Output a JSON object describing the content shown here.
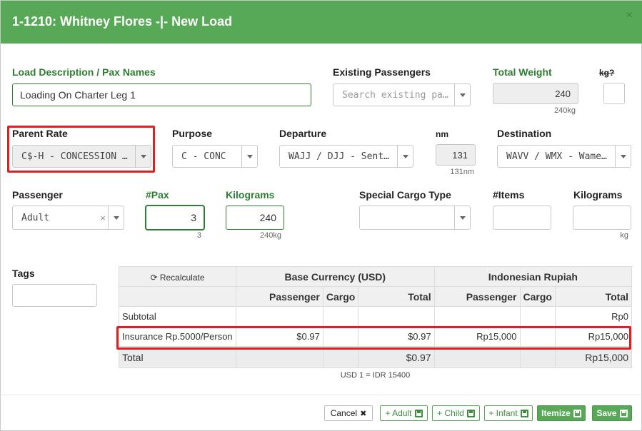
{
  "header": {
    "title": "1-1210: Whitney Flores -|- New Load",
    "close_glyph": "×"
  },
  "load_description": {
    "label": "Load Description / Pax Names",
    "value": "Loading On Charter Leg 1"
  },
  "existing_passengers": {
    "label": "Existing Passengers",
    "placeholder": "Search existing pa…"
  },
  "total_weight": {
    "label": "Total Weight",
    "value": "240",
    "sub": "240kg"
  },
  "kg_toggle": {
    "label": "kg?"
  },
  "parent_rate": {
    "label": "Parent Rate",
    "value": "C$-H - CONCESSION …"
  },
  "purpose": {
    "label": "Purpose",
    "value": "C - CONC"
  },
  "departure": {
    "label": "Departure",
    "value": "WAJJ / DJJ - Sent…"
  },
  "nm": {
    "label": "nm",
    "value": "131",
    "sub": "131nm"
  },
  "destination": {
    "label": "Destination",
    "value": "WAVV / WMX - Wame…"
  },
  "passenger": {
    "label": "Passenger",
    "value": "Adult",
    "clear_glyph": "×"
  },
  "pax": {
    "label": "#Pax",
    "value": "3",
    "sub": "3"
  },
  "kilograms": {
    "label": "Kilograms",
    "value": "240",
    "sub": "240kg"
  },
  "special_cargo": {
    "label": "Special Cargo Type",
    "value": ""
  },
  "items": {
    "label": "#Items",
    "value": ""
  },
  "cargo_kilograms": {
    "label": "Kilograms",
    "value": "",
    "sub": "kg"
  },
  "tags": {
    "label": "Tags",
    "value": ""
  },
  "fees_table": {
    "recalculate": "Recalculate",
    "base_currency": "Base Currency (USD)",
    "local_currency": "Indonesian Rupiah",
    "col_passenger": "Passenger",
    "col_cargo": "Cargo",
    "col_total": "Total",
    "rows": [
      {
        "label": "Subtotal",
        "usd_passenger": "",
        "usd_cargo": "",
        "usd_total": "",
        "idr_passenger": "",
        "idr_cargo": "",
        "idr_total": "Rp0"
      },
      {
        "label": "Insurance Rp.5000/Person",
        "usd_passenger": "$0.97",
        "usd_cargo": "",
        "usd_total": "$0.97",
        "idr_passenger": "Rp15,000",
        "idr_cargo": "",
        "idr_total": "Rp15,000"
      }
    ],
    "total": {
      "label": "Total",
      "usd_total": "$0.97",
      "idr_total": "Rp15,000"
    },
    "exchange_rate": "USD 1 = IDR 15400"
  },
  "footer": {
    "cancel": "Cancel",
    "cancel_glyph": "✖",
    "add_adult": "+ Adult",
    "add_child": "+ Child",
    "add_infant": "+ Infant",
    "itemize": "Itemize",
    "save": "Save"
  },
  "colors": {
    "header_bg": "#57a957",
    "label_green": "#2e7d32",
    "highlight_red": "#e02020"
  }
}
